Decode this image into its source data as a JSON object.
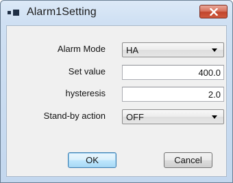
{
  "window": {
    "title": "Alarm1Setting",
    "close_icon": "close-x-icon",
    "app_icon": "app-icon"
  },
  "form": {
    "alarm_mode": {
      "label": "Alarm Mode",
      "value": "HA"
    },
    "set_value": {
      "label": "Set value",
      "value": "400.0"
    },
    "hysteresis": {
      "label": "hysteresis",
      "value": "2.0"
    },
    "standby_action": {
      "label": "Stand-by action",
      "value": "OFF"
    }
  },
  "buttons": {
    "ok_label": "OK",
    "cancel_label": "Cancel"
  },
  "colors": {
    "close_button": "#c2452c",
    "default_button_border": "#3c7fb1",
    "title_bar": "#c3d7ee"
  }
}
